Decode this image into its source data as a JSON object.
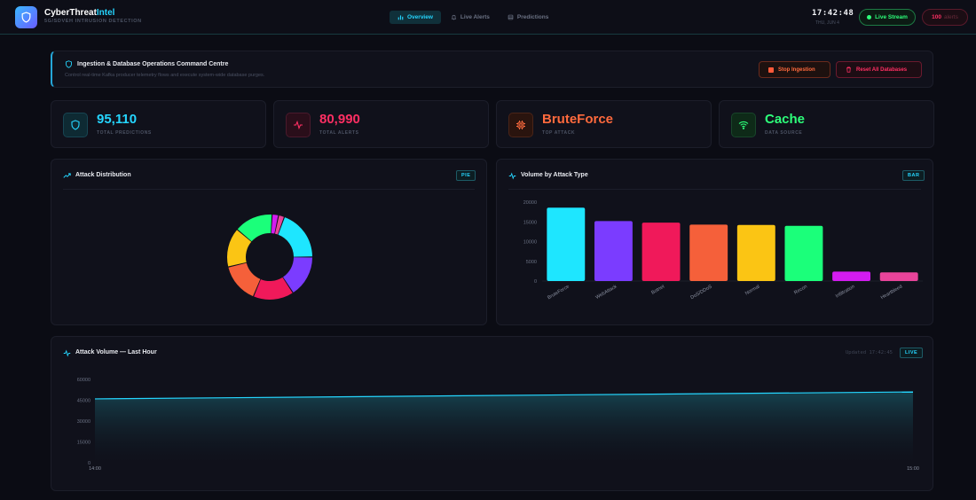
{
  "header": {
    "brand_main": "CyberThreat",
    "brand_accent": "Intel",
    "subtitle": "5G/SDVEH INTRUSION DETECTION",
    "tabs": [
      {
        "label": "Overview",
        "icon": "bar-chart-icon",
        "active": true
      },
      {
        "label": "Live Alerts",
        "icon": "bell-icon",
        "active": false
      },
      {
        "label": "Predictions",
        "icon": "database-icon",
        "active": false
      }
    ],
    "clock": "17:42:48",
    "date": "THU, JUN 4",
    "live_label": "Live Stream",
    "alert_count": "100",
    "alert_label": "alerts"
  },
  "command": {
    "title": "Ingestion & Database Operations Command Centre",
    "subtitle": "Control real-time Kafka producer telemetry flows and execute system-wide database purges.",
    "stop_label": "Stop Ingestion",
    "reset_label": "Reset All Databases"
  },
  "stats": [
    {
      "value": "95,110",
      "label": "TOTAL PREDICTIONS",
      "icon": "shield-icon",
      "color": "#25d6ff"
    },
    {
      "value": "80,990",
      "label": "TOTAL ALERTS",
      "icon": "pulse-icon",
      "color": "#ff2f63"
    },
    {
      "value": "BruteForce",
      "label": "TOP ATTACK",
      "icon": "cpu-icon",
      "color": "#ff6a3d"
    },
    {
      "value": "Cache",
      "label": "DATA SOURCE",
      "icon": "wifi-icon",
      "color": "#2dff7a"
    }
  ],
  "pie_panel": {
    "title": "Attack Distribution",
    "tag": "PIE"
  },
  "bar_panel": {
    "title": "Volume by Attack Type",
    "tag": "BAR"
  },
  "line_panel": {
    "title": "Attack Volume — Last Hour",
    "updated": "Updated 17:42:45",
    "tag": "LIVE"
  },
  "chart_data": [
    {
      "type": "pie",
      "categories": [
        "BruteForce",
        "WebAttack",
        "Botnet",
        "DoS/DDoS",
        "Normal",
        "Recon",
        "Infiltration",
        "Heartbleed"
      ],
      "values": [
        18200,
        14900,
        14500,
        14100,
        14000,
        13800,
        2300,
        2100
      ],
      "colors": [
        "#1ee6ff",
        "#7b3cff",
        "#f0195a",
        "#f5603a",
        "#fbc514",
        "#1bff7a",
        "#d31cf0",
        "#e8449a"
      ]
    },
    {
      "type": "bar",
      "categories": [
        "BruteForce",
        "WebAttack",
        "Botnet",
        "DoS/DDoS",
        "Normal",
        "Recon",
        "Infiltration",
        "Heartbleed"
      ],
      "values": [
        18600,
        15200,
        14800,
        14300,
        14200,
        14000,
        2400,
        2200
      ],
      "colors": [
        "#1ee6ff",
        "#7b3cff",
        "#f0195a",
        "#f5603a",
        "#fbc514",
        "#1bff7a",
        "#d31cf0",
        "#e8449a"
      ],
      "ylim": [
        0,
        20000
      ],
      "yticks": [
        0,
        5000,
        10000,
        15000,
        20000
      ]
    },
    {
      "type": "area",
      "x": [
        "14:00",
        "15:00"
      ],
      "y": [
        46000,
        51000
      ],
      "ylim": [
        0,
        60000
      ],
      "yticks": [
        0,
        15000,
        30000,
        45000,
        60000
      ],
      "color": "#25d6ff"
    }
  ]
}
